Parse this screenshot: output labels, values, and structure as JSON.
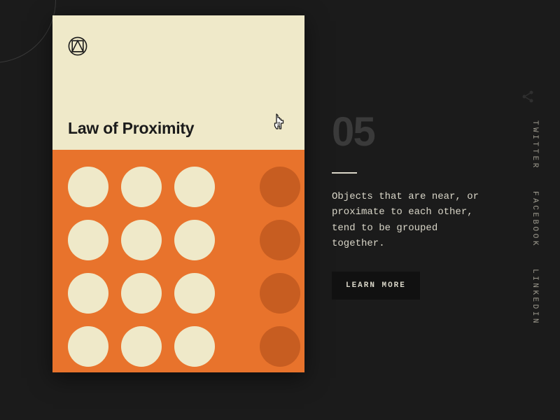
{
  "card": {
    "title": "Law of Proximity",
    "number": "05",
    "description": "Objects that are near, or proximate to each other, tend to be grouped together.",
    "cta_label": "LEARN MORE",
    "dot_grid": {
      "rows": 4,
      "columns_group_a": 3,
      "columns_group_b": 1,
      "color_light": "#efe9c9",
      "color_dark": "#c75d21",
      "bg": "#e8732c"
    }
  },
  "social": {
    "items": [
      "TWITTER",
      "FACEBOOK",
      "LINKEDIN"
    ]
  }
}
